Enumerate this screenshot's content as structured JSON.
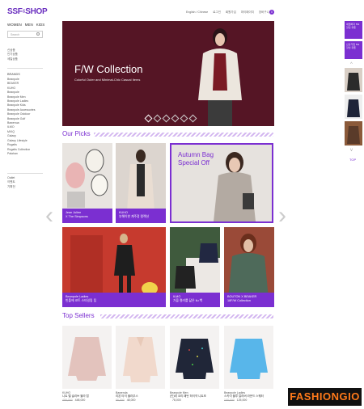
{
  "header": {
    "logo_main": "SSF",
    "logo_amp": "&",
    "logo_shop": "SHOP",
    "top_links": [
      "English / Chinese",
      "로그인",
      "회원가입",
      "마이페이지",
      "장바구니"
    ],
    "cart_count": "0"
  },
  "category_nav": [
    "WOMEN",
    "MEN",
    "KIDS"
  ],
  "search": {
    "placeholder": "Search"
  },
  "left_menu": {
    "top_items": [
      "신상품",
      "인기상품",
      "세일상품"
    ],
    "brands_title": "BRANDS",
    "brands": [
      "Beanpole",
      "BEAKER",
      "KUHO",
      "Beanpole",
      "Beanpole Men",
      "Beanpole Ladies",
      "Beanpole Kids",
      "Beanpole Accessories",
      "Beanpole Outdoor",
      "Beanpole Golf",
      "Bawenua",
      "ILMO",
      "MVIQ",
      "Galaxy",
      "Galaxy Lifestyle",
      "Rogatis",
      "Rogatis Collection",
      "Palahan"
    ],
    "bottom_items": [
      "Outlet",
      "이벤트",
      "기획전"
    ]
  },
  "hero": {
    "title": "F/W Collection",
    "subtitle": "Colorful Outer and Minimal-Chic Casual Items",
    "slides": 6,
    "active": 0
  },
  "our_picks": {
    "title": "Our Picks",
    "cards": [
      {
        "line1": "Jean Julien",
        "line2": "X The Simpsons"
      },
      {
        "line1": "KUHO",
        "line2": "부해이한 계주정 컬렉션"
      },
      {
        "title": "Autumn Bag Special Off"
      },
      {
        "line1": "Beanpole Ladies",
        "line2": "빈폴에 코트 스타일링 팁"
      },
      {
        "line1": "ILMO",
        "line2": "가을 컬러를 닮은 Ilu 백"
      },
      {
        "line1": "BOUTON X BEAKER",
        "line2": "18F/W Collection"
      }
    ]
  },
  "top_sellers": {
    "title": "Top Sellers",
    "items": [
      {
        "brand": "KUHO",
        "name": "니트 벨 슬리브 블라 탑",
        "old_price": "468,000",
        "price": "448,000"
      },
      {
        "brand": "Bawenda",
        "name": "리본 타이 블라우스",
        "old_price": "56,000",
        "price": "48,000"
      },
      {
        "brand": "Beanpole Men",
        "name": "(인)테 코리 패턴 하이넥 니트조",
        "old_price": "",
        "price": "78,000"
      },
      {
        "brand": "Beanpole Ladies",
        "name": "스카이 블루 칼라버 라운드 스웨터",
        "old_price": "100,000",
        "price": "125,000"
      }
    ]
  },
  "right_bar": {
    "banner1": "네임하다 5% 할인 쿠폰",
    "banner2": "신규가입 5% 할인 쿠폰",
    "top_label": "TOP"
  },
  "watermark": "FASHIONGIO",
  "colors": {
    "accent": "#7b2fd1",
    "hero_bg": "#551525"
  }
}
